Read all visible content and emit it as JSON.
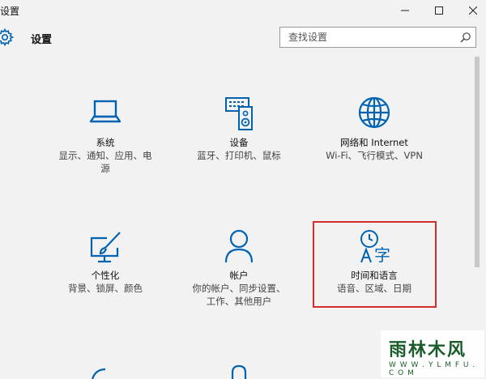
{
  "window": {
    "title": "设置",
    "minimize_glyph": "—",
    "maximize_glyph": "☐",
    "close_glyph": "✕"
  },
  "header": {
    "title": "设置",
    "icon": "gear-icon"
  },
  "search": {
    "placeholder": "查找设置",
    "icon": "search-icon"
  },
  "tiles": [
    {
      "name": "系统",
      "desc_line1": "显示、通知、应用、电",
      "desc_line2": "源",
      "icon": "laptop-icon"
    },
    {
      "name": "设备",
      "desc_line1": "蓝牙、打印机、鼠标",
      "desc_line2": "",
      "icon": "keyboard-speaker-icon"
    },
    {
      "name": "网络和 Internet",
      "desc_line1": "Wi-Fi、飞行模式、VPN",
      "desc_line2": "",
      "icon": "globe-icon"
    },
    {
      "name": "个性化",
      "desc_line1": "背景、锁屏、颜色",
      "desc_line2": "",
      "icon": "paint-monitor-icon"
    },
    {
      "name": "帐户",
      "desc_line1": "你的帐户、同步设置、",
      "desc_line2": "工作、其他用户",
      "icon": "person-icon"
    },
    {
      "name": "时间和语言",
      "desc_line1": "语音、区域、日期",
      "desc_line2": "",
      "icon": "time-language-icon"
    }
  ],
  "watermark": {
    "main": "雨林木风",
    "url": "W W W . Y L M F U . C O M"
  },
  "colors": {
    "accent": "#0063b1",
    "highlight": "#d62b2b",
    "background": "#f2f2f2"
  }
}
